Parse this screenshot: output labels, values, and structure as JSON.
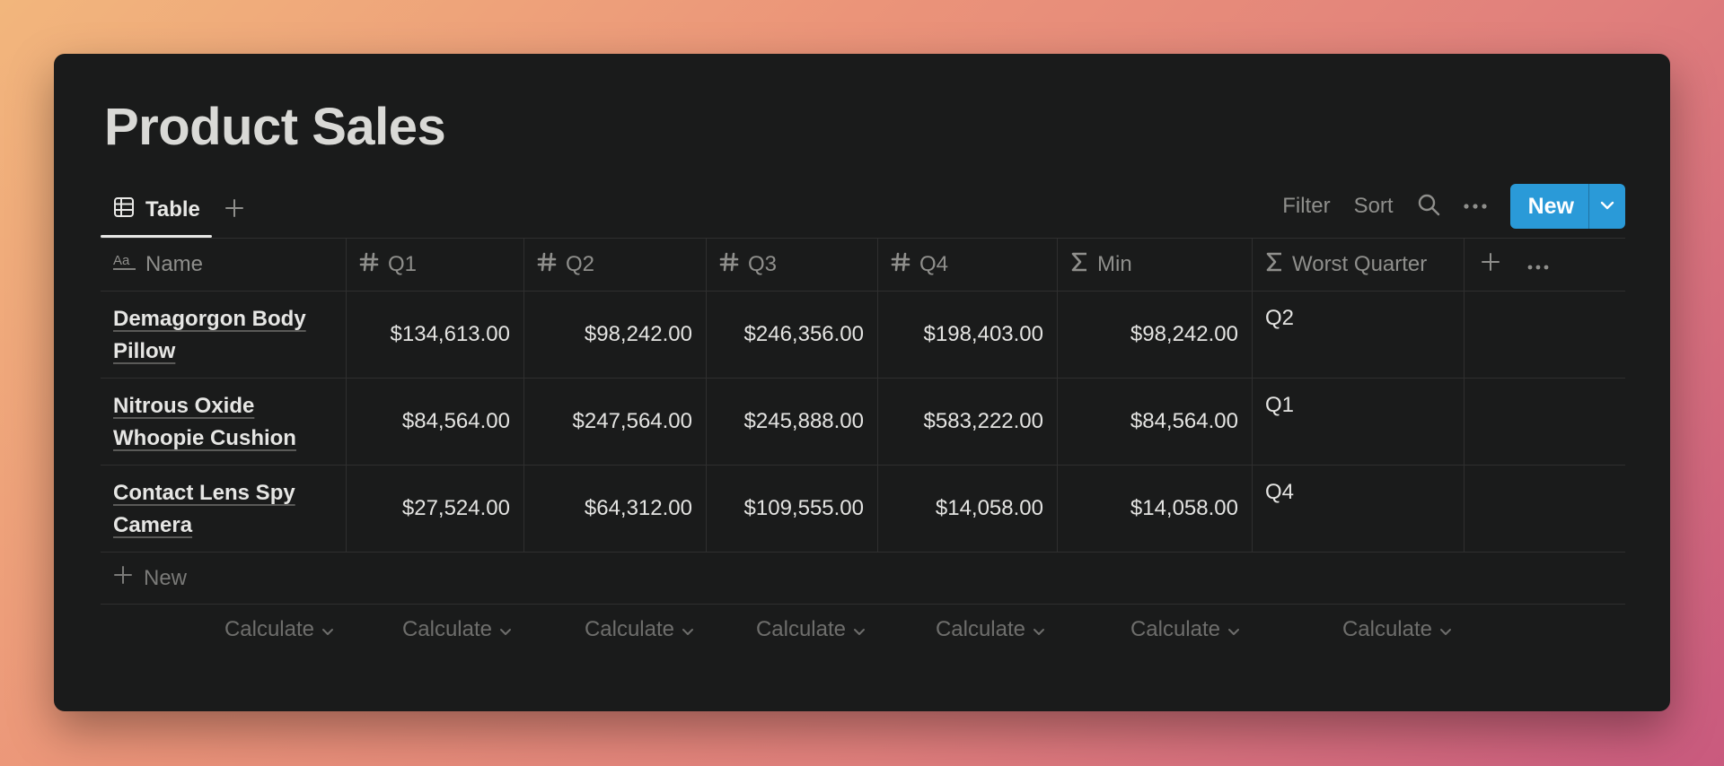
{
  "page": {
    "title": "Product Sales"
  },
  "view_tabs": {
    "active_label": "Table"
  },
  "toolbar": {
    "filter_label": "Filter",
    "sort_label": "Sort",
    "new_label": "New"
  },
  "columns": {
    "name": "Name",
    "q1": "Q1",
    "q2": "Q2",
    "q3": "Q3",
    "q4": "Q4",
    "min": "Min",
    "worst": "Worst Quarter"
  },
  "rows": [
    {
      "name": "Demagorgon Body Pillow",
      "q1": "$134,613.00",
      "q2": "$98,242.00",
      "q3": "$246,356.00",
      "q4": "$198,403.00",
      "min": "$98,242.00",
      "worst": "Q2"
    },
    {
      "name": "Nitrous Oxide Whoopie Cushion",
      "q1": "$84,564.00",
      "q2": "$247,564.00",
      "q3": "$245,888.00",
      "q4": "$583,222.00",
      "min": "$84,564.00",
      "worst": "Q1"
    },
    {
      "name": "Contact Lens Spy Camera",
      "q1": "$27,524.00",
      "q2": "$64,312.00",
      "q3": "$109,555.00",
      "q4": "$14,058.00",
      "min": "$14,058.00",
      "worst": "Q4"
    }
  ],
  "new_row_label": "New",
  "calculate_label": "Calculate",
  "icons": {
    "view_tab": "table-icon",
    "add_view": "plus-icon",
    "search": "search-icon",
    "more": "more-horizontal-icon",
    "new_dropdown": "chevron-down-icon",
    "name_column": "text-property-icon",
    "number_column": "hash-icon",
    "formula_column": "sigma-icon"
  },
  "colors": {
    "background": "#1a1b1b",
    "accent": "#2a9ad8",
    "text_primary": "#e4e4e2",
    "text_muted": "#8f8f8c"
  }
}
